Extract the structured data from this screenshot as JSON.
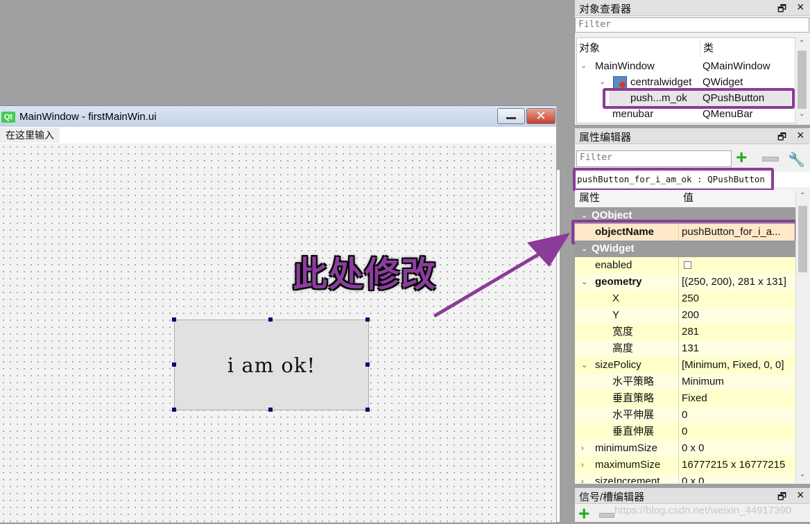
{
  "form_window": {
    "title": "MainWindow - firstMainWin.ui",
    "qt_logo": "Qt",
    "menu_placeholder": "在这里输入",
    "close_glyph": "✕"
  },
  "push_button": {
    "text": "i am ok!"
  },
  "annotation": {
    "text": "此处修改"
  },
  "object_inspector": {
    "title": "对象查看器",
    "filter_placeholder": "Filter",
    "col_object": "对象",
    "col_class": "类",
    "rows": [
      {
        "name": "MainWindow",
        "class": "QMainWindow"
      },
      {
        "name": "centralwidget",
        "class": "QWidget"
      },
      {
        "name": "push...m_ok",
        "class": "QPushButton"
      },
      {
        "name": "menubar",
        "class": "QMenuBar"
      }
    ]
  },
  "property_editor": {
    "title": "属性编辑器",
    "filter_placeholder": "Filter",
    "object_label": "pushButton_for_i_am_ok : QPushButton",
    "col_property": "属性",
    "col_value": "值",
    "rows": [
      {
        "key": "QObject",
        "value": ""
      },
      {
        "key": "objectName",
        "value": "pushButton_for_i_a..."
      },
      {
        "key": "QWidget",
        "value": ""
      },
      {
        "key": "enabled",
        "value": ""
      },
      {
        "key": "geometry",
        "value": "[(250, 200), 281 x 131]"
      },
      {
        "key": "X",
        "value": "250"
      },
      {
        "key": "Y",
        "value": "200"
      },
      {
        "key": "宽度",
        "value": "281"
      },
      {
        "key": "高度",
        "value": "131"
      },
      {
        "key": "sizePolicy",
        "value": "[Minimum, Fixed, 0, 0]"
      },
      {
        "key": "水平策略",
        "value": "Minimum"
      },
      {
        "key": "垂直策略",
        "value": "Fixed"
      },
      {
        "key": "水平伸展",
        "value": "0"
      },
      {
        "key": "垂直伸展",
        "value": "0"
      },
      {
        "key": "minimumSize",
        "value": "0 x 0"
      },
      {
        "key": "maximumSize",
        "value": "16777215 x 16777215"
      },
      {
        "key": "sizeIncrement",
        "value": "0 x 0"
      }
    ]
  },
  "signal_slot_editor": {
    "title": "信号/槽编辑器"
  },
  "watermark": "https://blog.csdn.net/weixin_44917390",
  "colors": {
    "annotation": "#8a3d9c",
    "highlight_box": "#8b3b98",
    "group_header": "#9c9c9c",
    "property_row": "#ffffcc"
  }
}
